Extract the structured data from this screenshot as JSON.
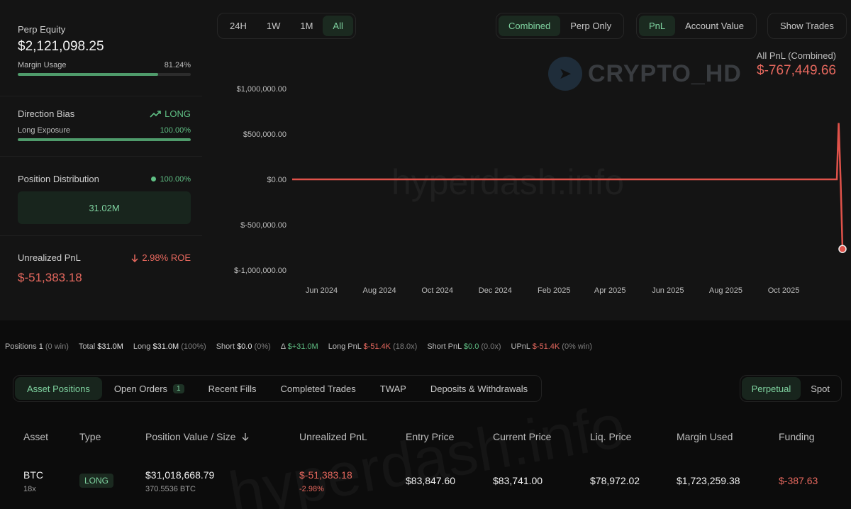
{
  "left": {
    "perp_equity_label": "Perp Equity",
    "perp_equity_value": "$2,121,098.25",
    "margin_usage_label": "Margin Usage",
    "margin_usage_value": "81.24%",
    "margin_usage_fraction": 0.8124,
    "direction_bias_label": "Direction Bias",
    "direction_bias_value": "LONG",
    "long_exposure_label": "Long Exposure",
    "long_exposure_value": "100.00%",
    "long_exposure_fraction": 1.0,
    "position_distribution_label": "Position Distribution",
    "position_distribution_pct": "100.00%",
    "position_distribution_amount": "31.02M",
    "unrealized_pnl_label": "Unrealized PnL",
    "unrealized_pnl_roe": "2.98% ROE",
    "unrealized_pnl_value": "$-51,383.18"
  },
  "range_tabs": [
    "24H",
    "1W",
    "1M",
    "All"
  ],
  "range_active": "All",
  "mode_tabs": [
    "Combined",
    "Perp Only"
  ],
  "mode_active": "Combined",
  "metric_tabs": [
    "PnL",
    "Account Value"
  ],
  "metric_active": "PnL",
  "show_trades_label": "Show Trades",
  "pnl_caption": "All PnL (Combined)",
  "pnl_value": "$-767,449.66",
  "watermark_logo_text": "CRYPTO_HD",
  "watermark_site_text": "hyperdash.info",
  "colors": {
    "accent_green": "#5fbf84",
    "loss_red": "#e6685e",
    "line_red": "#e0524a"
  },
  "chart_data": {
    "type": "line",
    "ylim": [
      -1000000,
      1000000
    ],
    "y_ticks": [
      1000000,
      500000,
      0,
      -500000,
      -1000000
    ],
    "y_tick_labels": [
      "$1,000,000.00",
      "$500,000.00",
      "$0.00",
      "$-500,000.00",
      "$-1,000,000.00"
    ],
    "x_tick_labels": [
      "Jun 2024",
      "Aug 2024",
      "Oct 2024",
      "Dec 2024",
      "Feb 2025",
      "Apr 2025",
      "Jun 2025",
      "Aug 2025",
      "Oct 2025"
    ],
    "x": [
      "2024-05-01",
      "2025-11-20",
      "2025-11-26",
      "2025-11-28",
      "2025-11-30",
      "2025-12-02"
    ],
    "values": [
      0,
      0,
      0,
      620000,
      0,
      -767449.66
    ],
    "grid": false
  },
  "stats": {
    "positions_label": "Positions",
    "positions_value": "1",
    "positions_note": "(0 win)",
    "total_label": "Total",
    "total_value": "$31.0M",
    "long_label": "Long",
    "long_value": "$31.0M",
    "long_note": "(100%)",
    "short_label": "Short",
    "short_value": "$0.0",
    "short_note": "(0%)",
    "delta_label": "Δ",
    "delta_value": "$+31.0M",
    "long_pnl_label": "Long PnL",
    "long_pnl_value": "$-51.4K",
    "long_pnl_note": "(18.0x)",
    "short_pnl_label": "Short PnL",
    "short_pnl_value": "$0.0",
    "short_pnl_note": "(0.0x)",
    "upnl_label": "UPnL",
    "upnl_value": "$-51.4K",
    "upnl_note": "(0% win)"
  },
  "tabs": [
    "Asset Positions",
    "Open Orders",
    "Recent Fills",
    "Completed Trades",
    "TWAP",
    "Deposits & Withdrawals"
  ],
  "tabs_active": "Asset Positions",
  "open_orders_count": "1",
  "market_tabs": [
    "Perpetual",
    "Spot"
  ],
  "market_active": "Perpetual",
  "table": {
    "headers": [
      "Asset",
      "Type",
      "Position Value / Size",
      "Unrealized PnL",
      "Entry Price",
      "Current Price",
      "Liq. Price",
      "Margin Used",
      "Funding"
    ],
    "row": {
      "asset": "BTC",
      "leverage": "18x",
      "type": "LONG",
      "position_value": "$31,018,668.79",
      "size": "370.5536 BTC",
      "unrealized_pnl": "$-51,383.18",
      "unrealized_pnl_pct": "-2.98%",
      "entry_price": "$83,847.60",
      "current_price": "$83,741.00",
      "liq_price": "$78,972.02",
      "margin_used": "$1,723,259.38",
      "funding": "$-387.63"
    }
  }
}
